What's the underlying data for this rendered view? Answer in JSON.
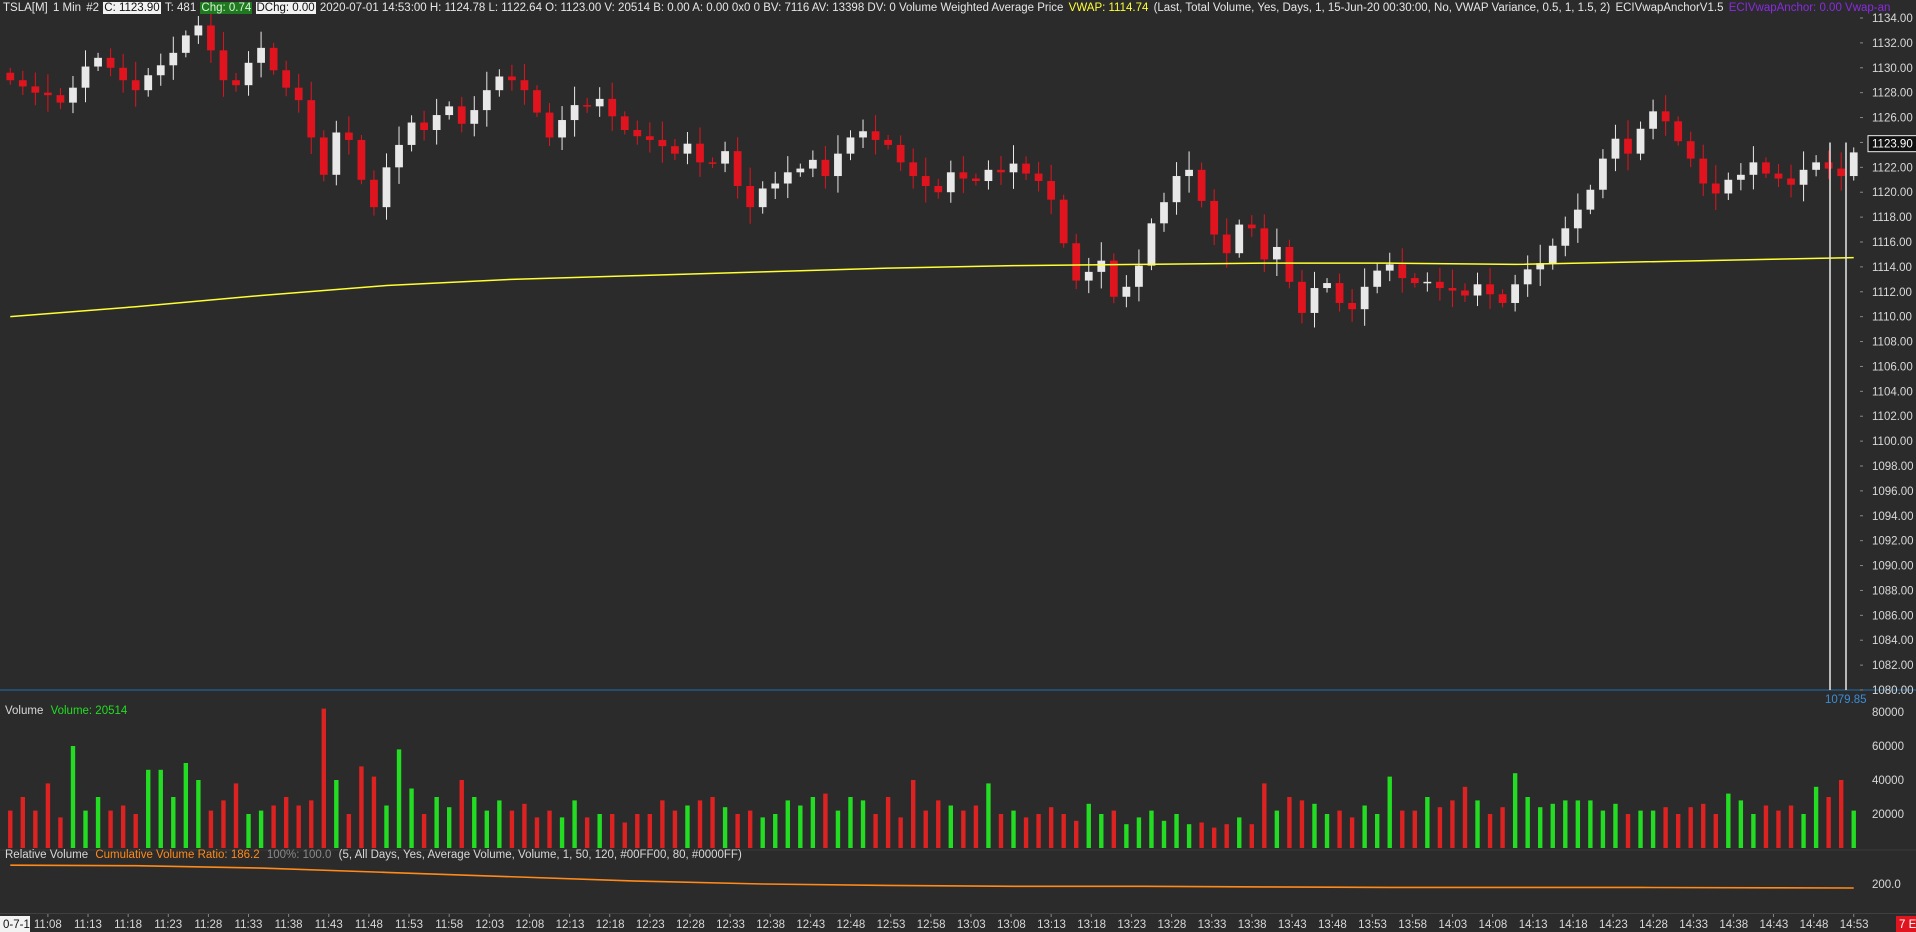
{
  "header": {
    "symbol": "TSLA[M]",
    "interval": "1 Min",
    "chart_num": "#2",
    "close": "C: 1123.90",
    "trades": "T: 481",
    "chg": "Chg: 0.74",
    "dchg": "DChg: 0.00",
    "details": "2020-07-01 14:53:00 H: 1124.78 L: 1122.64 O: 1123.00 V: 20514 B: 0.00 A: 0.00 0x0 0 BV: 7116 AV: 13398 DV: 0 Volume Weighted Average Price",
    "vwap_label": "VWAP: 1114.74",
    "vwap_params": "(Last, Total Volume, Yes, Days, 1, 15-Jun-20 00:30:00, No, VWAP Variance, 0.5, 1, 1.5, 2)",
    "study_name": "ECIVwapAnchorV1.5",
    "study_value": "ECIVwapAnchor: 0.00  Vwap-an"
  },
  "volume_panel": {
    "title": "Volume",
    "value_label": "Volume: 20514"
  },
  "rel_volume_panel": {
    "title": "Relative Volume",
    "ratio_label": "Cumulative Volume Ratio: 186.2",
    "pct_label": "100%: 100.0",
    "params": "(5, All Days, Yes, Average Volume, Volume, 1, 50, 120, #00FF00, 80, #0000FF)"
  },
  "price_axis_current_label": "1123.90",
  "low_marker_label": "1079.85",
  "date_label": "0-7-1",
  "right_corner_label": "7 E",
  "colors": {
    "background": "#2b2b2b",
    "up_candle": "#e8e8e8",
    "down_candle": "#e0141e",
    "vwap_line": "#ffff33",
    "vol_up": "#22dd22",
    "vol_down": "#dd2222",
    "rel_volume_line": "#ff8a1a"
  },
  "chart_data": [
    {
      "type": "candlestick",
      "title": "TSLA[M] 1 Min",
      "ylim": [
        1080,
        1134
      ],
      "y_ticks": [
        1080,
        1082,
        1084,
        1086,
        1088,
        1090,
        1092,
        1094,
        1096,
        1098,
        1100,
        1102,
        1104,
        1106,
        1108,
        1110,
        1112,
        1114,
        1116,
        1118,
        1120,
        1122,
        1124,
        1126,
        1128,
        1130,
        1132,
        1134
      ],
      "x_ticks": [
        "11:08",
        "11:13",
        "11:18",
        "11:23",
        "11:28",
        "11:33",
        "11:38",
        "11:43",
        "11:48",
        "11:53",
        "11:58",
        "12:03",
        "12:08",
        "12:13",
        "12:18",
        "12:23",
        "12:28",
        "12:33",
        "12:38",
        "12:43",
        "12:48",
        "12:53",
        "12:58",
        "13:03",
        "13:08",
        "13:13",
        "13:18",
        "13:23",
        "13:28",
        "13:33",
        "13:38",
        "13:43",
        "13:48",
        "13:53",
        "13:58",
        "14:03",
        "14:08",
        "14:13",
        "14:18",
        "14:23",
        "14:28",
        "14:33",
        "14:38",
        "14:43",
        "14:48",
        "14:53"
      ],
      "close_path": [
        [
          0,
          1129
        ],
        [
          1,
          1128.5
        ],
        [
          2,
          1128
        ],
        [
          3,
          1127.8
        ],
        [
          4,
          1127.2
        ],
        [
          5,
          1128.4
        ],
        [
          6,
          1130.1
        ],
        [
          7,
          1130.8
        ],
        [
          8,
          1130
        ],
        [
          9,
          1129
        ],
        [
          10,
          1128.2
        ],
        [
          11,
          1129.4
        ],
        [
          12,
          1130.2
        ],
        [
          13,
          1131.2
        ],
        [
          14,
          1132.6
        ],
        [
          15,
          1133.4
        ],
        [
          16,
          1131.4
        ],
        [
          17,
          1129
        ],
        [
          18,
          1128.6
        ],
        [
          19,
          1130.4
        ],
        [
          20,
          1131.6
        ],
        [
          21,
          1129.8
        ],
        [
          22,
          1128.4
        ],
        [
          23,
          1127.4
        ],
        [
          24,
          1124.4
        ],
        [
          25,
          1121.4
        ],
        [
          26,
          1124.8
        ],
        [
          27,
          1124.2
        ],
        [
          28,
          1121
        ],
        [
          29,
          1118.8
        ],
        [
          30,
          1122
        ],
        [
          31,
          1123.8
        ],
        [
          32,
          1125.6
        ],
        [
          33,
          1125
        ],
        [
          34,
          1126.2
        ],
        [
          35,
          1126.9
        ],
        [
          36,
          1125.5
        ],
        [
          37,
          1126.6
        ],
        [
          38,
          1128.2
        ],
        [
          39,
          1129.3
        ],
        [
          40,
          1129
        ],
        [
          41,
          1128.2
        ],
        [
          42,
          1126.4
        ],
        [
          43,
          1124.4
        ],
        [
          44,
          1125.8
        ],
        [
          45,
          1127
        ],
        [
          46,
          1126.9
        ],
        [
          47,
          1127.5
        ],
        [
          48,
          1126.1
        ],
        [
          49,
          1125
        ],
        [
          50,
          1124.5
        ],
        [
          51,
          1124.2
        ],
        [
          52,
          1123.7
        ],
        [
          53,
          1123.1
        ],
        [
          54,
          1123.9
        ],
        [
          55,
          1122.4
        ],
        [
          56,
          1122.3
        ],
        [
          57,
          1123.3
        ],
        [
          58,
          1120.5
        ],
        [
          59,
          1118.8
        ],
        [
          60,
          1120.3
        ],
        [
          61,
          1120.7
        ],
        [
          62,
          1121.6
        ],
        [
          63,
          1121.9
        ],
        [
          64,
          1122.6
        ],
        [
          65,
          1121.3
        ],
        [
          66,
          1123.1
        ],
        [
          67,
          1124.4
        ],
        [
          68,
          1124.9
        ],
        [
          69,
          1124.2
        ],
        [
          70,
          1123.8
        ],
        [
          71,
          1122.4
        ],
        [
          72,
          1121.3
        ],
        [
          73,
          1120.5
        ],
        [
          74,
          1120
        ],
        [
          75,
          1121.6
        ],
        [
          76,
          1121.1
        ],
        [
          77,
          1120.9
        ],
        [
          78,
          1121.8
        ],
        [
          79,
          1121.6
        ],
        [
          80,
          1122.3
        ],
        [
          81,
          1121.5
        ],
        [
          82,
          1120.9
        ],
        [
          83,
          1119.4
        ],
        [
          84,
          1115.9
        ],
        [
          85,
          1112.9
        ],
        [
          86,
          1113.6
        ],
        [
          87,
          1114.5
        ],
        [
          88,
          1111.6
        ],
        [
          89,
          1112.4
        ],
        [
          90,
          1114.1
        ],
        [
          91,
          1117.5
        ],
        [
          92,
          1119.2
        ],
        [
          93,
          1121.3
        ],
        [
          94,
          1121.8
        ],
        [
          95,
          1119.3
        ],
        [
          96,
          1116.6
        ],
        [
          97,
          1115.1
        ],
        [
          98,
          1117.4
        ],
        [
          99,
          1117.1
        ],
        [
          100,
          1114.6
        ],
        [
          101,
          1115.6
        ],
        [
          102,
          1112.8
        ],
        [
          103,
          1110.3
        ],
        [
          104,
          1112.3
        ],
        [
          105,
          1112.7
        ],
        [
          106,
          1111.1
        ],
        [
          107,
          1110.6
        ],
        [
          108,
          1112.4
        ],
        [
          109,
          1113.7
        ],
        [
          110,
          1114.2
        ],
        [
          111,
          1113.1
        ],
        [
          112,
          1112.7
        ],
        [
          113,
          1112.8
        ],
        [
          114,
          1112.3
        ],
        [
          115,
          1112.1
        ],
        [
          116,
          1111.7
        ],
        [
          117,
          1112.6
        ],
        [
          118,
          1111.8
        ],
        [
          119,
          1111.1
        ],
        [
          120,
          1112.6
        ],
        [
          121,
          1113.8
        ],
        [
          122,
          1114.3
        ],
        [
          123,
          1115.7
        ],
        [
          124,
          1117.1
        ],
        [
          125,
          1118.6
        ],
        [
          126,
          1120.2
        ],
        [
          127,
          1122.7
        ],
        [
          128,
          1124.3
        ],
        [
          129,
          1123.1
        ],
        [
          130,
          1125.1
        ],
        [
          131,
          1126.5
        ],
        [
          132,
          1125.7
        ],
        [
          133,
          1124.1
        ],
        [
          134,
          1122.7
        ],
        [
          135,
          1120.7
        ],
        [
          136,
          1119.9
        ],
        [
          137,
          1121
        ],
        [
          138,
          1121.4
        ],
        [
          139,
          1122.4
        ],
        [
          140,
          1121.5
        ],
        [
          141,
          1121.1
        ],
        [
          142,
          1120.6
        ],
        [
          143,
          1121.8
        ],
        [
          144,
          1122.4
        ],
        [
          145,
          1121.9
        ],
        [
          146,
          1121.3
        ],
        [
          147,
          1123.2
        ]
      ],
      "series": [
        {
          "name": "VWAP: 1114.74",
          "x_end_value": 1114.74,
          "values": [
            [
              0,
              1110
            ],
            [
              10,
              1110.8
            ],
            [
              20,
              1111.7
            ],
            [
              30,
              1112.5
            ],
            [
              40,
              1113
            ],
            [
              50,
              1113.3
            ],
            [
              60,
              1113.6
            ],
            [
              70,
              1113.9
            ],
            [
              80,
              1114.1
            ],
            [
              90,
              1114.2
            ],
            [
              100,
              1114.3
            ],
            [
              110,
              1114.3
            ],
            [
              120,
              1114.2
            ],
            [
              130,
              1114.4
            ],
            [
              140,
              1114.6
            ],
            [
              147,
              1114.74
            ]
          ]
        }
      ],
      "last": {
        "label": "C: 1123.90",
        "high": 1124.78,
        "low": 1122.64,
        "open": 1123.0,
        "close": 1123.9
      }
    },
    {
      "type": "bar",
      "title": "Volume",
      "ylim": [
        0,
        90000
      ],
      "y_ticks": [
        20000,
        40000,
        60000,
        80000
      ],
      "values": [
        22000,
        30000,
        22000,
        38000,
        18000,
        60000,
        22000,
        30000,
        22000,
        25000,
        20000,
        46000,
        46000,
        30000,
        50000,
        40000,
        22000,
        28000,
        38000,
        20000,
        22000,
        25000,
        30000,
        25000,
        28000,
        82000,
        40000,
        20000,
        48000,
        42000,
        25000,
        58000,
        35000,
        20000,
        30000,
        24000,
        40000,
        30000,
        22000,
        28000,
        22000,
        26000,
        18000,
        22000,
        18000,
        28000,
        18000,
        20000,
        20000,
        15000,
        20000,
        20000,
        28000,
        22000,
        25000,
        28000,
        30000,
        24000,
        20000,
        22000,
        18000,
        20000,
        28000,
        25000,
        30000,
        32000,
        22000,
        30000,
        28000,
        20000,
        30000,
        18000,
        40000,
        22000,
        28000,
        25000,
        22000,
        25000,
        38000,
        20000,
        22000,
        18000,
        20000,
        24000,
        20000,
        16000,
        26000,
        20000,
        22000,
        14000,
        18000,
        22000,
        16000,
        20000,
        14000,
        15000,
        12000,
        14000,
        18000,
        14000,
        38000,
        22000,
        30000,
        28000,
        26000,
        20000,
        22000,
        18000,
        25000,
        20000,
        42000,
        22000,
        22000,
        30000,
        24000,
        28000,
        36000,
        28000,
        20000,
        24000,
        44000,
        30000,
        24000,
        26000,
        28000,
        28000,
        28000,
        22000,
        26000,
        20000,
        22000,
        22000,
        24000,
        20000,
        24000,
        26000,
        20000,
        32000,
        28000,
        20000,
        25000,
        22000,
        25000,
        20000,
        36000,
        30000,
        40000,
        22000
      ],
      "colors": "per-candle direction (green up / red down)",
      "last_value": "Volume: 20514"
    },
    {
      "type": "line",
      "title": "Relative Volume",
      "ylim": [
        100,
        300
      ],
      "y_ticks": [
        200
      ],
      "series": [
        {
          "name": "Cumulative Volume Ratio: 186.2",
          "values": [
            [
              0,
              265
            ],
            [
              10,
              263
            ],
            [
              20,
              255
            ],
            [
              30,
              240
            ],
            [
              40,
              225
            ],
            [
              50,
              210
            ],
            [
              60,
              200
            ],
            [
              70,
              195
            ],
            [
              80,
              192
            ],
            [
              90,
              192
            ],
            [
              100,
              190
            ],
            [
              110,
              188
            ],
            [
              120,
              188
            ],
            [
              130,
              188
            ],
            [
              140,
              187
            ],
            [
              147,
              186.2
            ]
          ]
        }
      ]
    }
  ]
}
